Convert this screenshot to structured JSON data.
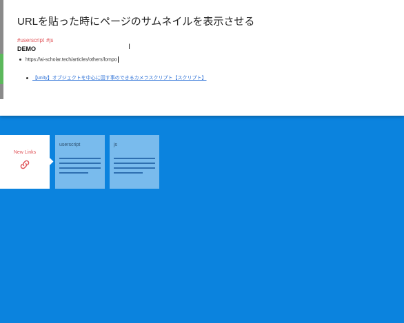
{
  "editor": {
    "title": "URLを貼った時にページのサムネイルを表示させる",
    "hashtags": [
      "#userscript",
      "#js"
    ],
    "demo_label": "DEMO",
    "url_text": "https://ai-scholar.tech/articles/others/lompo",
    "link_text": "【unity】オブジェクトを中心に回す事のできるカメラスクリプト【スクリプト】"
  },
  "cards": {
    "new_links": {
      "label": "New Links",
      "icon": "link-icon"
    },
    "tags": [
      {
        "title": "userscript"
      },
      {
        "title": "js"
      }
    ]
  },
  "colors": {
    "background": "#0b83de",
    "accent_red": "#e0555a",
    "link_blue": "#2a6fd6"
  }
}
